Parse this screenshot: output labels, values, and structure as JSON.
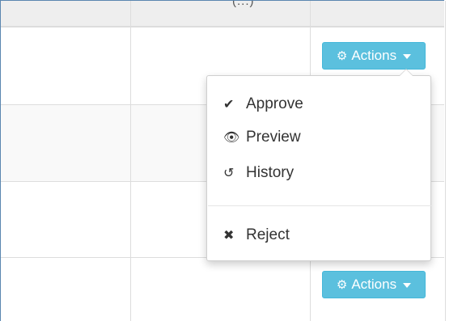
{
  "actions_menu": {
    "button_label": "Actions",
    "items": [
      {
        "label": "Approve",
        "icon": "check-icon"
      },
      {
        "label": "Preview",
        "icon": "eye-icon"
      },
      {
        "label": "History",
        "icon": "history-icon"
      }
    ],
    "danger_item": {
      "label": "Reject",
      "icon": "times-icon"
    }
  },
  "row_actions": [
    {
      "button_label": "Actions"
    },
    {
      "button_label": "Actions"
    }
  ],
  "colors": {
    "button_bg": "#5bc0de",
    "frame_border": "#5b86b0",
    "row_alt": "#f9f9f9"
  }
}
